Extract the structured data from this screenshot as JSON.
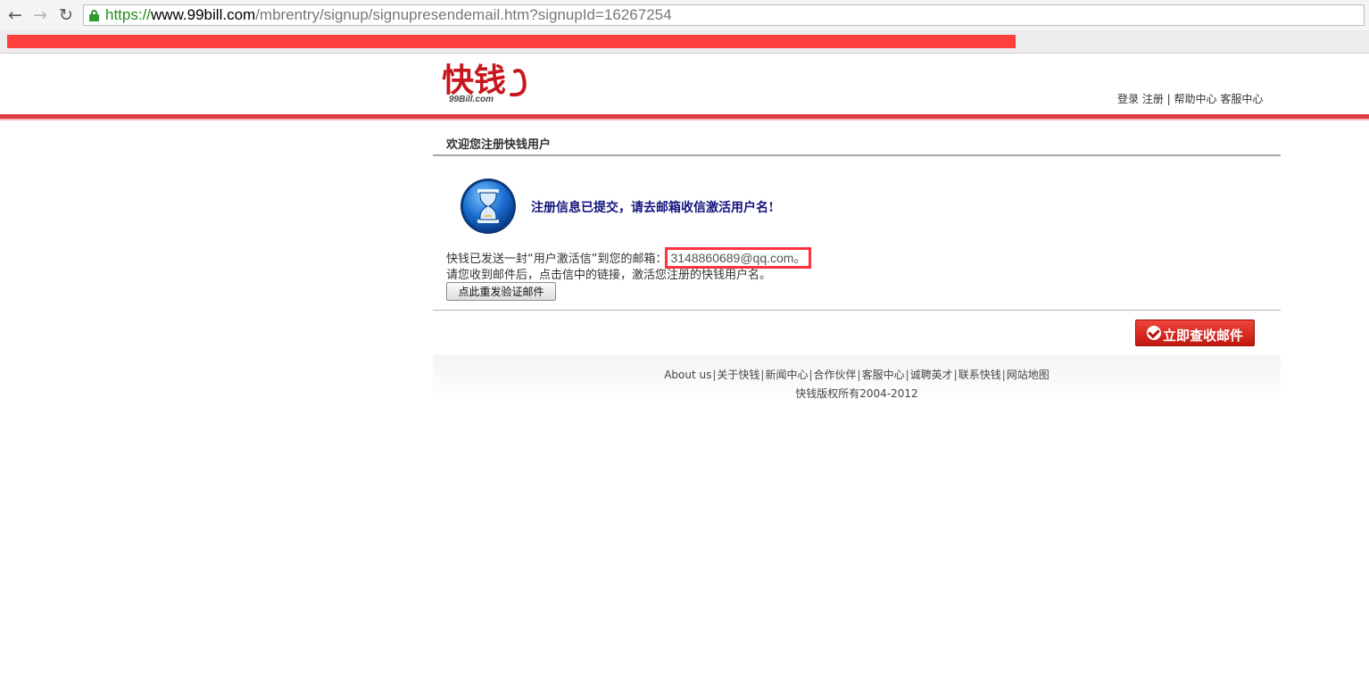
{
  "browser": {
    "url_scheme": "https://",
    "url_host": "www.99bill.com",
    "url_path": "/mbrentry/signup/signupresendemail.htm?signupId=16267254",
    "back_icon": "←",
    "forward_icon": "→",
    "reload_icon": "↻"
  },
  "header": {
    "logo_text": "快钱",
    "logo_subtext": "99Bill.com",
    "links": {
      "login": "登录",
      "register": "注册",
      "help_center": "帮助中心",
      "customer_center": "客服中心"
    },
    "brand_color": "#e23c43"
  },
  "main": {
    "title": "欢迎您注册快钱用户",
    "notice": "注册信息已提交，请去邮箱收信激活用户名!",
    "sent_text": "快钱已发送一封“用户激活信”到您的邮箱：",
    "email": "3148860689@qq.com。",
    "instruction": "请您收到邮件后，点击信中的链接，激活您注册的快钱用户名。",
    "resend_button": "点此重发验证邮件",
    "check_mail_button": "立即查收邮件"
  },
  "footer": {
    "links": [
      "About us",
      "关于快钱",
      "新闻中心",
      "合作伙伴",
      "客服中心",
      "诚聘英才",
      "联系快钱",
      "网站地图"
    ],
    "copyright": "快钱版权所有2004-2012"
  }
}
